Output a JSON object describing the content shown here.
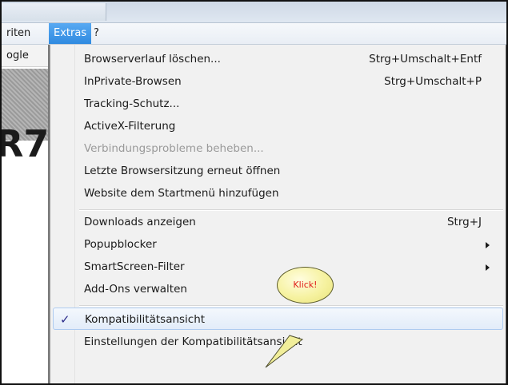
{
  "menubar": {
    "left_fragment": "riten",
    "extras": "Extras",
    "help": "?"
  },
  "page": {
    "left_tab_fragment": "ogle",
    "left_big_fragment": "R7"
  },
  "menu": {
    "items": [
      {
        "label": "Browserverlauf löschen...",
        "shortcut": "Strg+Umschalt+Entf"
      },
      {
        "label": "InPrivate-Browsen",
        "shortcut": "Strg+Umschalt+P"
      },
      {
        "label": "Tracking-Schutz...",
        "shortcut": ""
      },
      {
        "label": "ActiveX-Filterung",
        "shortcut": ""
      },
      {
        "label": "Verbindungsprobleme beheben...",
        "shortcut": "",
        "disabled": true
      },
      {
        "label": "Letzte Browsersitzung erneut öffnen",
        "shortcut": ""
      },
      {
        "label": "Website dem Startmenü hinzufügen",
        "shortcut": ""
      },
      {
        "label": "Downloads anzeigen",
        "shortcut": "Strg+J"
      },
      {
        "label": "Popupblocker",
        "shortcut": "",
        "submenu": true
      },
      {
        "label": "SmartScreen-Filter",
        "shortcut": "",
        "submenu": true
      },
      {
        "label": "Add-Ons verwalten",
        "shortcut": ""
      },
      {
        "label": "Kompatibilitätsansicht",
        "shortcut": "",
        "checked": true,
        "highlighted": true
      },
      {
        "label": "Einstellungen der Kompatibilitätsansicht",
        "shortcut": ""
      }
    ],
    "check_glyph": "✓"
  },
  "callout": {
    "text": "Klick!"
  },
  "colors": {
    "menu_active": "#3399ff",
    "callout_text": "#e0201a",
    "callout_fill": "#f6f2a0"
  }
}
